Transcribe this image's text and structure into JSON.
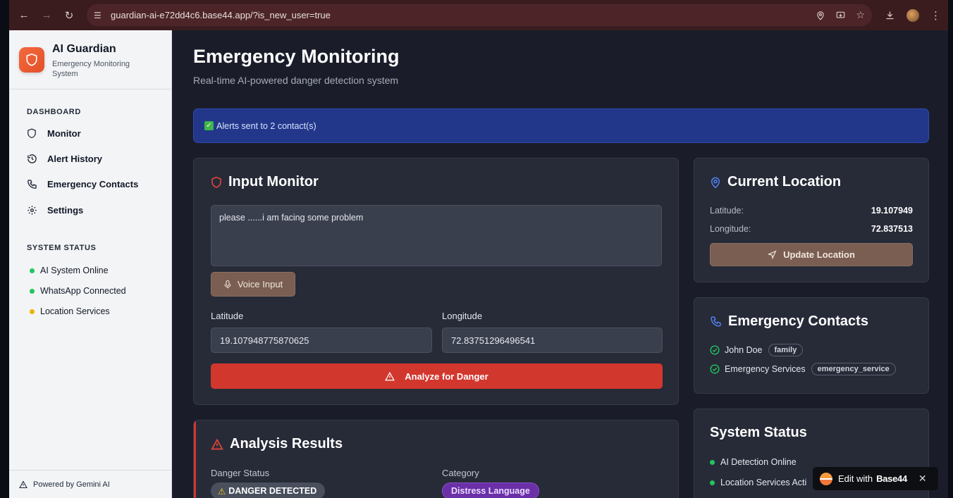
{
  "browser": {
    "url": "guardian-ai-e72dd4c6.base44.app/?is_new_user=true"
  },
  "sidebar": {
    "brand_title": "AI Guardian",
    "brand_subtitle": "Emergency Monitoring System",
    "dashboard_label": "DASHBOARD",
    "nav": [
      {
        "label": "Monitor",
        "icon": "shield-icon"
      },
      {
        "label": "Alert History",
        "icon": "history-icon"
      },
      {
        "label": "Emergency Contacts",
        "icon": "phone-icon"
      },
      {
        "label": "Settings",
        "icon": "gear-icon"
      }
    ],
    "system_status_label": "SYSTEM STATUS",
    "status": [
      {
        "label": "AI System Online",
        "color": "#22c55e"
      },
      {
        "label": "WhatsApp Connected",
        "color": "#22c55e"
      },
      {
        "label": "Location Services",
        "color": "#eab308"
      }
    ],
    "footer": "Powered by Gemini AI"
  },
  "header": {
    "title": "Emergency Monitoring",
    "subtitle": "Real-time AI-powered danger detection system"
  },
  "alert_banner": "Alerts sent to 2 contact(s)",
  "input_monitor": {
    "title": "Input Monitor",
    "message": "please ......i am facing some problem",
    "voice_label": "Voice Input",
    "latitude_label": "Latitude",
    "latitude_value": "19.107948775870625",
    "longitude_label": "Longitude",
    "longitude_value": "72.83751296496541",
    "analyze_label": "Analyze for Danger"
  },
  "current_location": {
    "title": "Current Location",
    "latitude_label": "Latitude:",
    "latitude_value": "19.107949",
    "longitude_label": "Longitude:",
    "longitude_value": "72.837513",
    "update_label": "Update Location"
  },
  "emergency_contacts": {
    "title": "Emergency Contacts",
    "contacts": [
      {
        "name": "John Doe",
        "tag": "family"
      },
      {
        "name": "Emergency Services",
        "tag": "emergency_service"
      }
    ]
  },
  "system_status": {
    "title": "System Status",
    "items": [
      {
        "label": "AI Detection Online",
        "color": "#22c55e"
      },
      {
        "label": "Location Services Acti",
        "color": "#22c55e"
      }
    ]
  },
  "analysis": {
    "title": "Analysis Results",
    "status_label": "Danger Status",
    "status_value": "DANGER DETECTED",
    "category_label": "Category",
    "category_value": "Distress Language"
  },
  "edit_pill": {
    "prefix": "Edit with",
    "brand": "Base44"
  },
  "colors": {
    "accent_red": "#d2372e",
    "banner_blue": "#22378a",
    "brand_orange": "#f26a3d"
  }
}
